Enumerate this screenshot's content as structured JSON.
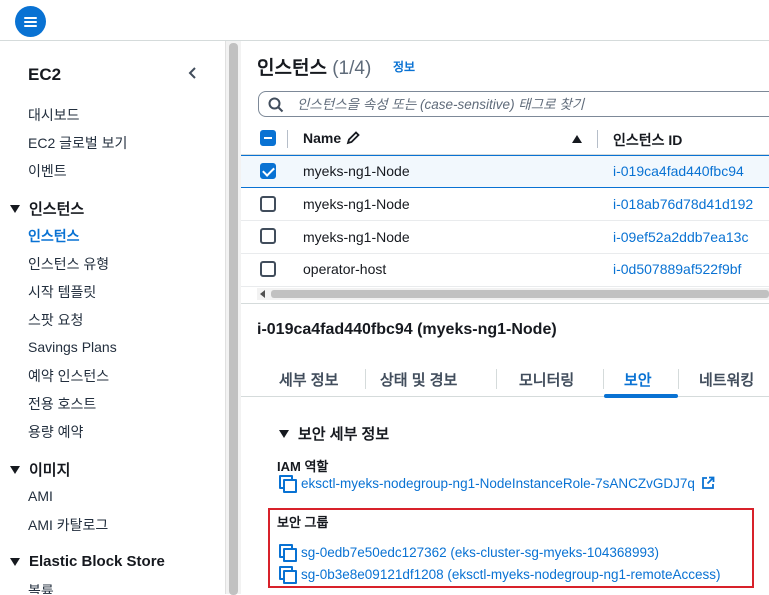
{
  "sidebar": {
    "title": "EC2",
    "items_top": [
      "대시보드",
      "EC2 글로벌 보기",
      "이벤트"
    ],
    "section_instances": "인스턴스",
    "instances_items": [
      "인스턴스",
      "인스턴스 유형",
      "시작 템플릿",
      "스팟 요청",
      "Savings Plans",
      "예약 인스턴스",
      "전용 호스트",
      "용량 예약"
    ],
    "section_images": "이미지",
    "images_items": [
      "AMI",
      "AMI 카탈로그"
    ],
    "section_ebs": "Elastic Block Store",
    "ebs_items": [
      "볼륨"
    ]
  },
  "main": {
    "heading": "인스턴스",
    "count": "(1/4)",
    "info": "정보",
    "search_placeholder": "인스턴스을 속성 또는 (case-sensitive) 태그로 찾기",
    "columns": {
      "name": "Name",
      "id": "인스턴스 ID"
    },
    "rows": [
      {
        "name": "myeks-ng1-Node",
        "id": "i-019ca4fad440fbc94",
        "checked": true
      },
      {
        "name": "myeks-ng1-Node",
        "id": "i-018ab76d78d41d192",
        "checked": false
      },
      {
        "name": "myeks-ng1-Node",
        "id": "i-09ef52a2ddb7ea13c",
        "checked": false
      },
      {
        "name": "operator-host",
        "id": "i-0d507889af522f9bf",
        "checked": false
      }
    ]
  },
  "detail": {
    "title": "i-019ca4fad440fbc94 (myeks-ng1-Node)",
    "tabs": [
      "세부 정보",
      "상태 및 경보",
      "모니터링",
      "보안",
      "네트워킹"
    ],
    "active_tab": "보안",
    "section": "보안 세부 정보",
    "iam_label": "IAM 역할",
    "iam_role": "eksctl-myeks-nodegroup-ng1-NodeInstanceRole-7sANCZvGDJ7q",
    "sg_label": "보안 그룹",
    "security_groups": [
      "sg-0edb7e50edc127362 (eks-cluster-sg-myeks-104368993)",
      "sg-0b3e8e09121df1208 (eksctl-myeks-nodegroup-ng1-remoteAccess)"
    ]
  },
  "colors": {
    "accent": "#0972d3",
    "highlight": "#d8212a"
  }
}
